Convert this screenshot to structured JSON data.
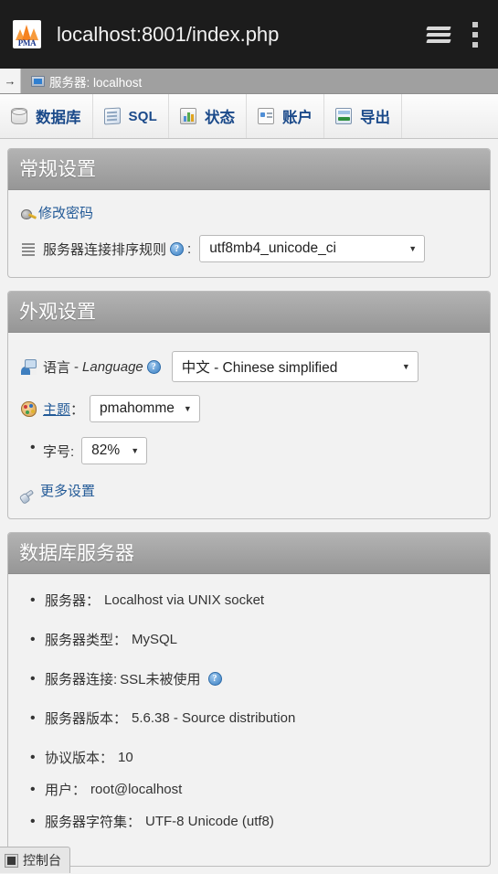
{
  "browser": {
    "url": "localhost:8001/index.php",
    "logo_text": "PMA",
    "tabs_icon": "tab-stack-icon",
    "menu_icon": "kebab-menu-icon"
  },
  "breadcrumb": {
    "arrow": "→",
    "text": "服务器: localhost"
  },
  "nav_tabs": [
    {
      "label": "数据库",
      "icon": "database-icon"
    },
    {
      "label": "SQL",
      "icon": "sql-scroll-icon"
    },
    {
      "label": "状态",
      "icon": "status-chart-icon"
    },
    {
      "label": "账户",
      "icon": "account-card-icon"
    },
    {
      "label": "导出",
      "icon": "export-icon"
    }
  ],
  "general_settings": {
    "title": "常规设置",
    "change_password": "修改密码",
    "collation_label": "服务器连接排序规则",
    "collation_colon": ":",
    "collation_value": "utf8mb4_unicode_ci",
    "help_glyph": "?"
  },
  "appearance_settings": {
    "title": "外观设置",
    "language_label_cn": "语言",
    "language_label_sep": "-",
    "language_label_en": "Language",
    "language_value": "中文 - Chinese simplified",
    "theme_label": "主题",
    "theme_colon": "：",
    "theme_value": "pmahomme",
    "fontsize_label": "字号:",
    "fontsize_value": "82%",
    "more_settings": "更多设置",
    "help_glyph": "?"
  },
  "database_server": {
    "title": "数据库服务器",
    "items": [
      {
        "label": "服务器：",
        "value": "Localhost via UNIX socket",
        "help": false
      },
      {
        "label": "服务器类型：",
        "value": "MySQL",
        "help": false
      },
      {
        "label": "服务器连接:",
        "value": "SSL未被使用",
        "help": true
      },
      {
        "label": "服务器版本：",
        "value": "5.6.38 - Source distribution",
        "help": false
      },
      {
        "label": "协议版本：",
        "value": "10",
        "help": false
      },
      {
        "label": "用户：",
        "value": "root@localhost",
        "help": false
      },
      {
        "label": "服务器字符集：",
        "value": "UTF-8 Unicode (utf8)",
        "help": false
      }
    ],
    "help_glyph": "?"
  },
  "console": {
    "label": "控制台"
  },
  "colors": {
    "chrome_bg": "#1c1c1c",
    "breadcrumb_bg": "#a0a0a0",
    "panel_header": "#969696",
    "link": "#235a97",
    "tab_label": "#1b4a8a"
  }
}
